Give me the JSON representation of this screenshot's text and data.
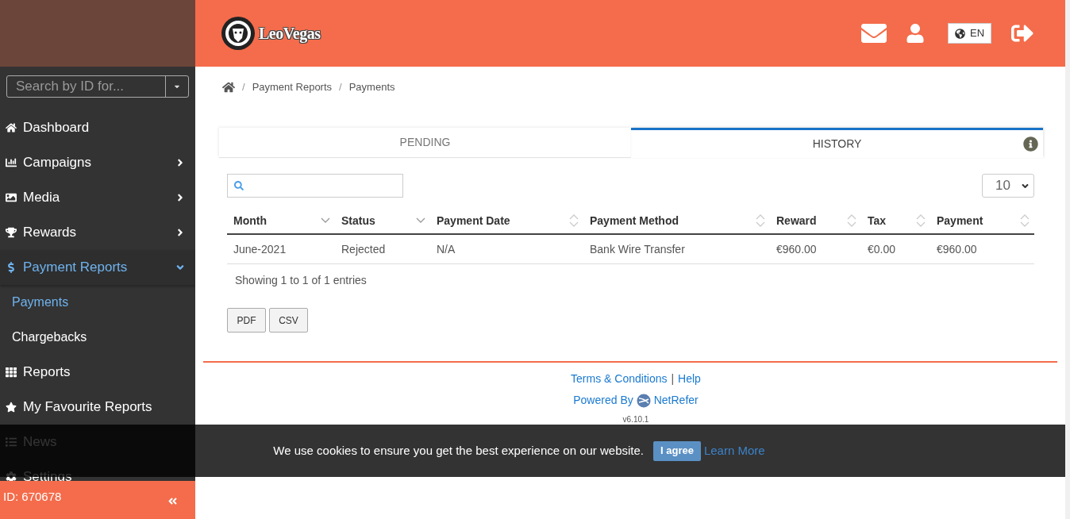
{
  "sidebar": {
    "search": {
      "placeholder": "Search by ID for..."
    },
    "items": [
      {
        "label": "Dashboard",
        "expandable": false,
        "selected": false
      },
      {
        "label": "Campaigns",
        "expandable": true,
        "expanded": false,
        "selected": false
      },
      {
        "label": "Media",
        "expandable": true,
        "expanded": false,
        "selected": false
      },
      {
        "label": "Rewards",
        "expandable": true,
        "expanded": false,
        "selected": false
      },
      {
        "label": "Payment Reports",
        "expandable": true,
        "expanded": true,
        "selected": true,
        "children": [
          {
            "label": "Payments",
            "selected": true
          },
          {
            "label": "Chargebacks",
            "selected": false
          }
        ]
      },
      {
        "label": "Reports",
        "expandable": false,
        "selected": false
      },
      {
        "label": "My Favourite Reports",
        "expandable": false,
        "selected": false
      },
      {
        "label": "News",
        "expandable": false,
        "selected": false
      },
      {
        "label": "Settings",
        "expandable": false,
        "selected": false
      }
    ],
    "footer": {
      "id": "ID: 670678"
    }
  },
  "header": {
    "logo": "LeoVegas",
    "language": "EN"
  },
  "breadcrumb": [
    {
      "kind": "home"
    },
    {
      "kind": "sep",
      "text": "/"
    },
    {
      "kind": "link",
      "text": "Payment Reports"
    },
    {
      "kind": "sep",
      "text": "/"
    },
    {
      "kind": "current",
      "text": "Payments"
    }
  ],
  "tabs": [
    {
      "label": "PENDING",
      "selected": false
    },
    {
      "label": "HISTORY",
      "selected": true
    }
  ],
  "table": {
    "page_length": "10",
    "columns": [
      {
        "label": "Month",
        "sorted": true
      },
      {
        "label": "Status",
        "sorted": true
      },
      {
        "label": "Payment Date",
        "sorted": false
      },
      {
        "label": "Payment Method",
        "sorted": false
      },
      {
        "label": "Reward",
        "sorted": false
      },
      {
        "label": "Tax",
        "sorted": false
      },
      {
        "label": "Payment",
        "sorted": false
      }
    ],
    "rows": [
      [
        "June-2021",
        "Rejected",
        "N/A",
        "Bank Wire Transfer",
        "€960.00",
        "€0.00",
        "€960.00"
      ]
    ],
    "info": "Showing 1 to 1 of 1 entries"
  },
  "export_buttons": [
    "PDF",
    "CSV"
  ],
  "footer": {
    "terms": "Terms & Conditions",
    "divider": "|",
    "help": "Help",
    "powered_by": "Powered By",
    "brand": "NetRefer",
    "version": "v6.10.1"
  },
  "cookie_banner": {
    "message": "We use cookies to ensure you get the best experience on our website.",
    "accept": "I agree",
    "learn_more": "Learn More"
  }
}
